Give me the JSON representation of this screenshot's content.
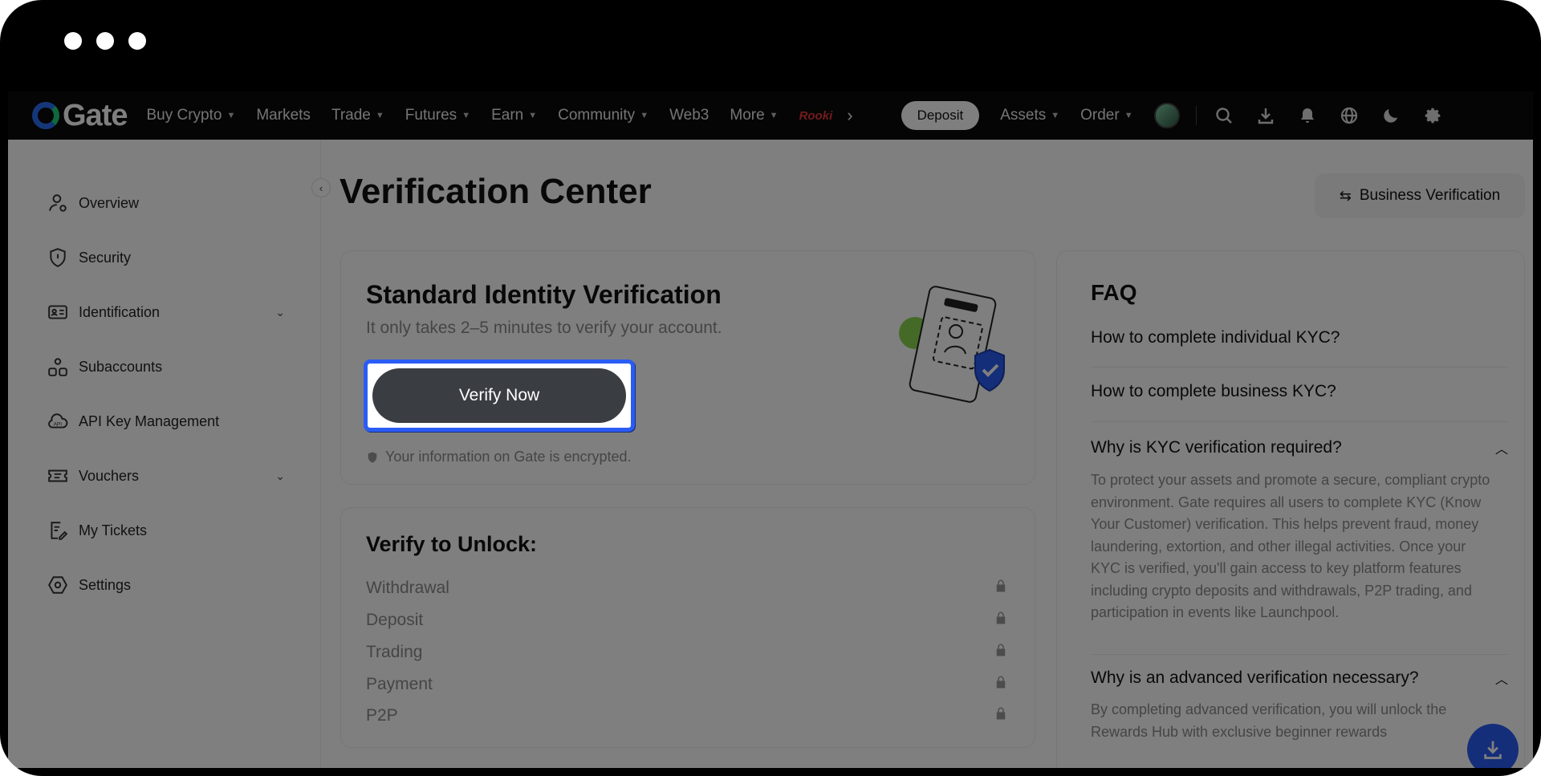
{
  "nav": {
    "logo": "Gate",
    "items": [
      {
        "label": "Buy Crypto",
        "caret": true
      },
      {
        "label": "Markets",
        "caret": false
      },
      {
        "label": "Trade",
        "caret": true
      },
      {
        "label": "Futures",
        "caret": true
      },
      {
        "label": "Earn",
        "caret": true
      },
      {
        "label": "Community",
        "caret": true
      },
      {
        "label": "Web3",
        "caret": false
      },
      {
        "label": "More",
        "caret": true
      }
    ],
    "promo": "Rooki",
    "deposit": "Deposit",
    "assets": "Assets",
    "order": "Order"
  },
  "sidebar": {
    "items": [
      {
        "label": "Overview",
        "icon": "user-icon"
      },
      {
        "label": "Security",
        "icon": "shield-icon"
      },
      {
        "label": "Identification",
        "icon": "id-card-icon",
        "expandable": true
      },
      {
        "label": "Subaccounts",
        "icon": "users-icon"
      },
      {
        "label": "API Key Management",
        "icon": "api-icon"
      },
      {
        "label": "Vouchers",
        "icon": "ticket-icon",
        "expandable": true
      },
      {
        "label": "My Tickets",
        "icon": "edit-document-icon"
      },
      {
        "label": "Settings",
        "icon": "gear-icon"
      }
    ]
  },
  "main": {
    "title": "Verification Center",
    "business_button": "Business Verification",
    "standard": {
      "title": "Standard Identity Verification",
      "subtitle": "It only takes 2–5 minutes to verify your account.",
      "button": "Verify Now",
      "encrypted": "Your information on Gate is encrypted."
    },
    "unlock": {
      "title": "Verify to Unlock:",
      "items": [
        "Withdrawal",
        "Deposit",
        "Trading",
        "Payment",
        "P2P"
      ]
    },
    "faq": {
      "title": "FAQ",
      "q1": "How to complete individual KYC?",
      "q2": "How to complete business KYC?",
      "q3": "Why is KYC verification required?",
      "a3": "To protect your assets and promote a secure, compliant crypto environment. Gate requires all users to complete KYC (Know Your Customer) verification. This helps prevent fraud, money laundering, extortion, and other illegal activities. Once your KYC is verified, you'll gain access to key platform features including crypto deposits and withdrawals, P2P trading, and participation in events like Launchpool.",
      "q4": "Why is an advanced verification necessary?",
      "a4": "By completing advanced verification, you will unlock the Rewards Hub with exclusive beginner rewards"
    }
  },
  "colors": {
    "accent": "#2a5cf5",
    "nav_bg": "#0b0b0b",
    "button_dark": "#3a3d42"
  }
}
